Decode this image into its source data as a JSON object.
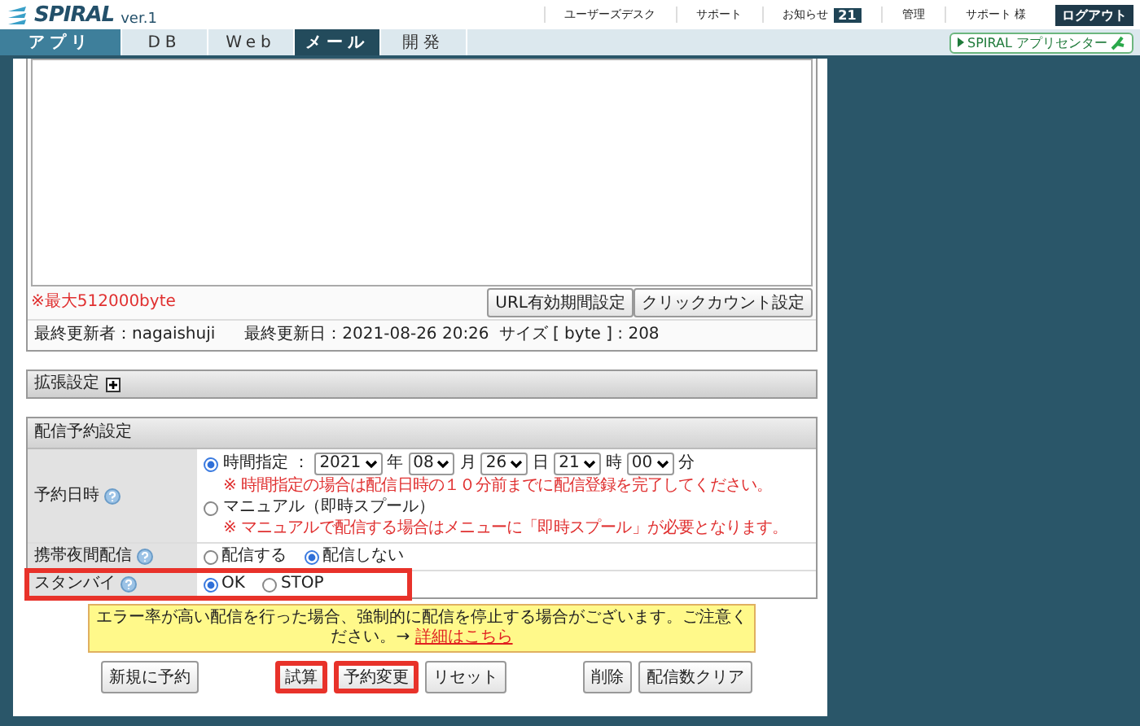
{
  "header": {
    "logo": "SPIRAL",
    "version": "ver.1",
    "links": [
      {
        "label": "ユーザーズデスク",
        "kind": "link"
      },
      {
        "label": "サポート",
        "kind": "link"
      },
      {
        "label": "お知らせ",
        "kind": "badge",
        "badge": "21"
      },
      {
        "label": "管理",
        "kind": "link"
      },
      {
        "label": "サポート 様",
        "kind": "text"
      },
      {
        "label": "ログアウト",
        "kind": "dark"
      }
    ]
  },
  "tabs": [
    {
      "label": "アプリ",
      "kind": "section",
      "selected": false
    },
    {
      "label": "DB",
      "kind": "tab",
      "selected": false
    },
    {
      "label": "Web",
      "kind": "tab",
      "selected": false
    },
    {
      "label": "メール",
      "kind": "tab",
      "selected": true
    },
    {
      "label": "開発",
      "kind": "tab",
      "selected": false
    }
  ],
  "app_center": "SPIRAL アプリセンター",
  "editor": {
    "limit_note": "※最大512000byte",
    "buttons": [
      "URL有効期間設定",
      "クリックカウント設定"
    ],
    "updater": "最終更新者：nagaishuji",
    "updated": "最終更新日：2021-08-26 20:26",
    "size": "サイズ [ byte ] : 208"
  },
  "extension": {
    "label": "拡張設定",
    "expanded": false
  },
  "schedule": {
    "title": "配信予約設定",
    "rows": [
      {
        "label": "予約日時",
        "kind": "datetime",
        "highlighted": false,
        "options": [
          {
            "label": "時間指定 ：",
            "selected": true,
            "selects": [
              {
                "value": "2021",
                "unit": "年"
              },
              {
                "value": "08",
                "unit": "月"
              },
              {
                "value": "26",
                "unit": "日"
              },
              {
                "value": "21",
                "unit": "時"
              },
              {
                "value": "00",
                "unit": "分"
              }
            ],
            "note": "※ 時間指定の場合は配信日時の１０分前までに配信登録を完了してください。"
          },
          {
            "label": "マニュアル（即時スプール）",
            "selected": false,
            "note": "※ マニュアルで配信する場合はメニューに「即時スプール」が必要となります。"
          }
        ]
      },
      {
        "label": "携帯夜間配信",
        "kind": "radios",
        "highlighted": false,
        "options": [
          {
            "label": "配信する",
            "selected": false
          },
          {
            "label": "配信しない",
            "selected": true
          }
        ]
      },
      {
        "label": "スタンバイ",
        "kind": "radios",
        "highlighted": true,
        "options": [
          {
            "label": "OK",
            "selected": true
          },
          {
            "label": "STOP",
            "selected": false
          }
        ]
      }
    ]
  },
  "warning": {
    "text": "エラー率が高い配信を行った場合、強制的に配信を停止する場合がございます。ご注意ください。→",
    "link": "詳細はこちら"
  },
  "button_groups": [
    [
      {
        "label": "新規に予約",
        "highlighted": false
      }
    ],
    [
      {
        "label": "試算",
        "highlighted": true
      },
      {
        "label": "予約変更",
        "highlighted": true
      },
      {
        "label": "リセット",
        "highlighted": false
      }
    ],
    [
      {
        "label": "削除",
        "highlighted": false
      },
      {
        "label": "配信数クリア",
        "highlighted": false
      }
    ]
  ]
}
